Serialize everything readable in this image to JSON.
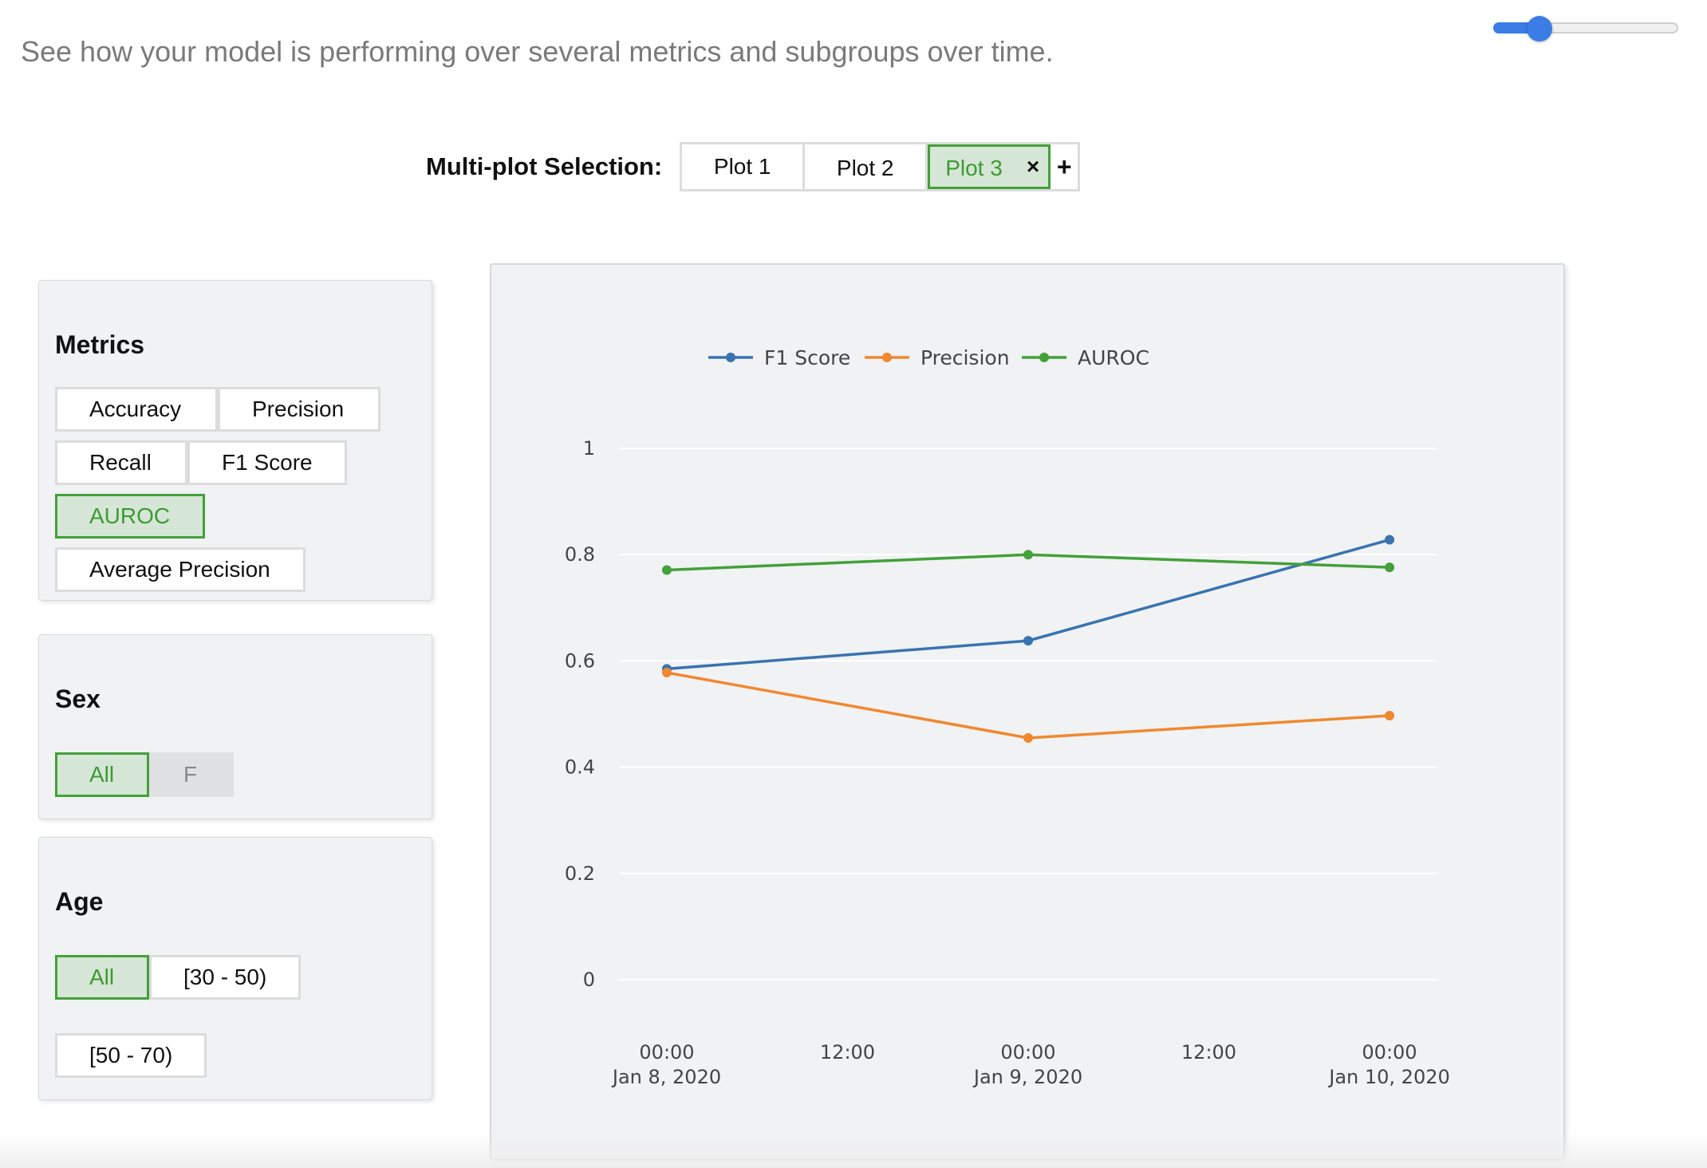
{
  "description": "See how your model is performing over several metrics and subgroups over time.",
  "zoom_slider": {
    "value_fraction": 0.25
  },
  "multiplot": {
    "label": "Multi-plot Selection:",
    "tabs": [
      "Plot 1",
      "Plot 2",
      "Plot 3"
    ],
    "active_tab": "Plot 3",
    "close_symbol": "×",
    "add_symbol": "+"
  },
  "metrics": {
    "title": "Metrics",
    "buttons": [
      "Accuracy",
      "Precision",
      "Recall",
      "F1 Score",
      "AUROC",
      "Average Precision"
    ],
    "selected": "AUROC"
  },
  "sex": {
    "title": "Sex",
    "buttons": [
      "All",
      "F"
    ],
    "selected": "All"
  },
  "age": {
    "title": "Age",
    "buttons": [
      "All",
      "[30 - 50)",
      "[50 - 70)"
    ],
    "selected": "All"
  },
  "colors": {
    "selected_green": "#43a03a",
    "slider_blue": "#3b7ce6",
    "f1": "#3a73b0",
    "precision": "#f0882f",
    "auroc": "#43a03a"
  },
  "chart_data": {
    "type": "line",
    "x": [
      "2020-01-08 00:00",
      "2020-01-09 00:00",
      "2020-01-10 00:00"
    ],
    "x_ticks": [
      {
        "time": "00:00",
        "date": "Jan 8, 2020"
      },
      {
        "time": "12:00",
        "date": ""
      },
      {
        "time": "00:00",
        "date": "Jan 9, 2020"
      },
      {
        "time": "12:00",
        "date": ""
      },
      {
        "time": "00:00",
        "date": "Jan 10, 2020"
      }
    ],
    "y_ticks": [
      "1",
      "0.8",
      "0.6",
      "0.4",
      "0.2",
      "0"
    ],
    "ylim": [
      0,
      1
    ],
    "grid": true,
    "legend_position": "top-left",
    "series": [
      {
        "name": "F1 Score",
        "color": "#3a73b0",
        "values": [
          0.585,
          0.638,
          0.828
        ]
      },
      {
        "name": "Precision",
        "color": "#f0882f",
        "values": [
          0.578,
          0.455,
          0.497
        ]
      },
      {
        "name": "AUROC",
        "color": "#43a03a",
        "values": [
          0.771,
          0.8,
          0.776
        ]
      }
    ]
  }
}
